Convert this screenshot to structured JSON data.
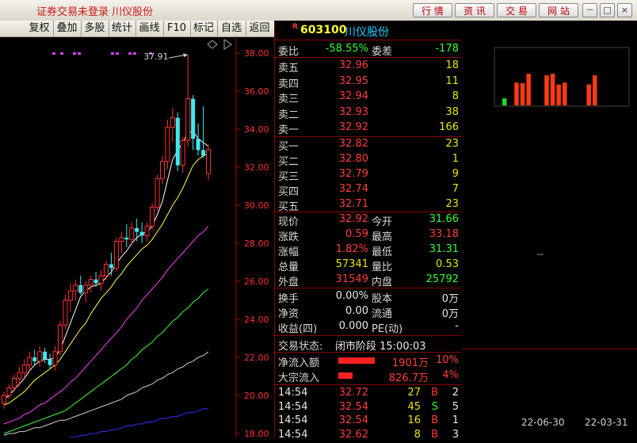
{
  "window": {
    "title": "证券交易未登录 川仪股份"
  },
  "top_buttons": [
    "行 情",
    "资 讯",
    "交 易",
    "网 站"
  ],
  "window_controls": {
    "minimize": "－",
    "maximize": "□",
    "close": "×"
  },
  "toolbar": [
    "复权",
    "叠加",
    "多股",
    "统计",
    "画线",
    "F10",
    "标记",
    "自选",
    "返回"
  ],
  "chart": {
    "y_ticks": [
      "38.00",
      "36.00",
      "34.00",
      "32.00",
      "30.00",
      "28.00",
      "26.00",
      "24.00",
      "22.00",
      "20.00",
      "18.00"
    ],
    "max_marker": "37.91",
    "colors": {
      "up": "#ff3030",
      "down": "#40e8f0",
      "ma5": "#ffffff",
      "ma10": "#ffff40",
      "ma20": "#ff40ff",
      "ma30": "#40ff40",
      "ma60": "#d0d0d0",
      "ma120": "#3030ff",
      "axis": "#b00000",
      "dots": "#d040ff"
    }
  },
  "chart_data": {
    "type": "candlestick",
    "ylim": [
      18,
      38.5
    ],
    "candles": [
      [
        19.6,
        20.2,
        19.3,
        20.0
      ],
      [
        20.0,
        20.6,
        19.8,
        20.4
      ],
      [
        20.4,
        21.1,
        20.2,
        20.9
      ],
      [
        20.9,
        21.5,
        20.5,
        21.2
      ],
      [
        21.2,
        21.9,
        20.9,
        21.6
      ],
      [
        21.6,
        22.3,
        21.3,
        22.0
      ],
      [
        22.0,
        22.4,
        21.6,
        21.8
      ],
      [
        21.8,
        22.6,
        21.5,
        22.3
      ],
      [
        22.3,
        22.5,
        21.7,
        21.9
      ],
      [
        21.9,
        22.2,
        21.4,
        21.6
      ],
      [
        21.6,
        22.6,
        21.3,
        22.3
      ],
      [
        22.3,
        23.9,
        22.1,
        23.7
      ],
      [
        23.7,
        25.3,
        23.5,
        25.0
      ],
      [
        25.0,
        25.9,
        24.4,
        25.5
      ],
      [
        25.5,
        26.1,
        25.0,
        25.8
      ],
      [
        25.8,
        26.3,
        25.3,
        25.4
      ],
      [
        25.4,
        26.0,
        24.9,
        25.8
      ],
      [
        25.8,
        26.3,
        25.4,
        26.1
      ],
      [
        26.1,
        26.5,
        25.7,
        25.9
      ],
      [
        25.9,
        26.6,
        25.5,
        26.3
      ],
      [
        26.3,
        27.1,
        26.1,
        26.9
      ],
      [
        26.9,
        27.5,
        26.3,
        26.7
      ],
      [
        26.7,
        28.3,
        26.5,
        28.1
      ],
      [
        28.1,
        28.6,
        27.5,
        28.3
      ],
      [
        28.3,
        29.0,
        27.8,
        28.2
      ],
      [
        28.2,
        29.1,
        27.9,
        28.8
      ],
      [
        28.8,
        29.3,
        28.1,
        28.6
      ],
      [
        28.6,
        29.1,
        28.0,
        28.4
      ],
      [
        28.4,
        29.1,
        28.1,
        28.9
      ],
      [
        28.9,
        30.1,
        28.7,
        29.9
      ],
      [
        29.9,
        31.6,
        29.7,
        31.4
      ],
      [
        31.4,
        32.6,
        31.1,
        32.3
      ],
      [
        32.3,
        34.5,
        31.9,
        34.1
      ],
      [
        34.1,
        35.1,
        33.3,
        34.6
      ],
      [
        34.6,
        34.9,
        31.8,
        32.1
      ],
      [
        32.1,
        33.6,
        31.7,
        33.4
      ],
      [
        33.4,
        37.91,
        33.1,
        35.6
      ],
      [
        35.6,
        35.8,
        32.9,
        33.5
      ],
      [
        33.5,
        34.3,
        32.6,
        32.9
      ],
      [
        32.9,
        35.2,
        32.5,
        32.6
      ],
      [
        31.66,
        33.18,
        31.31,
        32.92
      ]
    ],
    "ma": {
      "ma5": [
        19.8,
        20.0,
        20.3,
        20.6,
        20.9,
        21.3,
        21.6,
        21.8,
        21.9,
        21.9,
        22.0,
        22.4,
        23.1,
        23.8,
        24.5,
        25.2,
        25.5,
        25.7,
        25.8,
        25.9,
        26.2,
        26.5,
        26.9,
        27.3,
        27.6,
        28.0,
        28.3,
        28.5,
        28.6,
        28.9,
        29.5,
        30.2,
        31.3,
        32.4,
        32.9,
        33.3,
        33.8,
        33.9,
        33.5,
        33.3,
        33.1
      ],
      "ma10": [
        19.5,
        19.6,
        19.8,
        20.0,
        20.2,
        20.5,
        20.8,
        21.0,
        21.2,
        21.4,
        21.6,
        21.9,
        22.3,
        22.7,
        23.1,
        23.5,
        23.8,
        24.3,
        24.7,
        25.1,
        25.4,
        25.7,
        26.1,
        26.4,
        26.8,
        27.1,
        27.4,
        27.7,
        27.9,
        28.2,
        28.6,
        29.0,
        29.5,
        30.0,
        30.4,
        30.9,
        31.5,
        32.1,
        32.4,
        32.6,
        32.7
      ],
      "ma20": [
        18.5,
        18.6,
        18.7,
        18.8,
        19.0,
        19.1,
        19.3,
        19.5,
        19.6,
        19.8,
        20.0,
        20.2,
        20.4,
        20.7,
        20.9,
        21.2,
        21.5,
        21.8,
        22.1,
        22.4,
        22.7,
        23.0,
        23.3,
        23.6,
        24.0,
        24.3,
        24.6,
        25.0,
        25.3,
        25.6,
        25.9,
        26.2,
        26.6,
        26.9,
        27.2,
        27.5,
        27.8,
        28.1,
        28.4,
        28.6,
        28.9
      ],
      "ma30": [
        18.0,
        18.1,
        18.2,
        18.3,
        18.4,
        18.5,
        18.6,
        18.7,
        18.8,
        18.9,
        19.0,
        19.1,
        19.2,
        19.4,
        19.6,
        19.8,
        20.0,
        20.2,
        20.4,
        20.6,
        20.8,
        21.0,
        21.2,
        21.4,
        21.6,
        21.9,
        22.1,
        22.4,
        22.6,
        22.8,
        23.1,
        23.3,
        23.6,
        23.9,
        24.1,
        24.4,
        24.6,
        24.9,
        25.1,
        25.4,
        25.6
      ],
      "ma60": [
        17.9,
        18.0,
        18.0,
        18.1,
        18.1,
        18.2,
        18.3,
        18.3,
        18.4,
        18.5,
        18.6,
        18.7,
        18.7,
        18.8,
        18.9,
        19.0,
        19.1,
        19.2,
        19.3,
        19.4,
        19.5,
        19.6,
        19.7,
        19.8,
        20.0,
        20.1,
        20.2,
        20.4,
        20.5,
        20.6,
        20.8,
        20.9,
        21.1,
        21.2,
        21.4,
        21.5,
        21.7,
        21.8,
        22.0,
        22.1,
        22.3
      ],
      "ma120": [
        17.1,
        17.1,
        17.2,
        17.2,
        17.3,
        17.3,
        17.4,
        17.4,
        17.5,
        17.5,
        17.6,
        17.7,
        17.7,
        17.8,
        17.8,
        17.9,
        17.9,
        18.0,
        18.0,
        18.1,
        18.1,
        18.2,
        18.2,
        18.3,
        18.4,
        18.4,
        18.5,
        18.5,
        18.6,
        18.6,
        18.7,
        18.8,
        18.8,
        18.9,
        18.9,
        19.0,
        19.1,
        19.1,
        19.2,
        19.3,
        19.3
      ]
    }
  },
  "quote": {
    "prefix": "R",
    "code": "603100",
    "name": "川仪股份",
    "webi": {
      "label": "委比",
      "value": "-58.55%",
      "label2": "委差",
      "value2": "-178"
    },
    "sells": [
      {
        "label": "卖五",
        "price": "32.96",
        "vol": "18"
      },
      {
        "label": "卖四",
        "price": "32.95",
        "vol": "11"
      },
      {
        "label": "卖三",
        "price": "32.94",
        "vol": "8"
      },
      {
        "label": "卖二",
        "price": "32.93",
        "vol": "38"
      },
      {
        "label": "卖一",
        "price": "32.92",
        "vol": "166"
      }
    ],
    "buys": [
      {
        "label": "买一",
        "price": "32.82",
        "vol": "23"
      },
      {
        "label": "买二",
        "price": "32.80",
        "vol": "1"
      },
      {
        "label": "买三",
        "price": "32.79",
        "vol": "9"
      },
      {
        "label": "买四",
        "price": "32.74",
        "vol": "7"
      },
      {
        "label": "买五",
        "price": "32.71",
        "vol": "23"
      }
    ],
    "stats": [
      {
        "l1": "现价",
        "v1": "32.92",
        "c1": "red",
        "l2": "今开",
        "v2": "31.66",
        "c2": "green"
      },
      {
        "l1": "涨跌",
        "v1": "0.59",
        "c1": "red",
        "l2": "最高",
        "v2": "33.18",
        "c2": "red"
      },
      {
        "l1": "涨幅",
        "v1": "1.82%",
        "c1": "red",
        "l2": "最低",
        "v2": "31.31",
        "c2": "green"
      },
      {
        "l1": "总量",
        "v1": "57341",
        "c1": "yellow",
        "l2": "量比",
        "v2": "0.53",
        "c2": "yellow"
      },
      {
        "l1": "外盘",
        "v1": "31549",
        "c1": "red",
        "l2": "内盘",
        "v2": "25792",
        "c2": "green"
      }
    ],
    "stats2": [
      {
        "l1": "换手",
        "v1": "0.00%",
        "l2": "股本",
        "v2": "0万"
      },
      {
        "l1": "净资",
        "v1": "0.00",
        "l2": "流通",
        "v2": "0万"
      },
      {
        "l1": "收益(四)",
        "v1": "0.000",
        "l2": "PE(动)",
        "v2": "-"
      }
    ],
    "trade_status": {
      "label": "交易状态:",
      "value": "闭市阶段 15:00:03"
    },
    "flows": [
      {
        "label": "净流入额",
        "value": "1901万",
        "pct": "10%",
        "fraction": 0.1
      },
      {
        "label": "大宗流入",
        "value": "826.7万",
        "pct": "4%",
        "fraction": 0.04
      }
    ],
    "ticks": [
      {
        "time": "14:54",
        "price": "32.72",
        "vol": "27",
        "side": "B",
        "n": "2"
      },
      {
        "time": "14:54",
        "price": "32.54",
        "vol": "45",
        "side": "S",
        "n": "5"
      },
      {
        "time": "14:54",
        "price": "32.54",
        "vol": "16",
        "side": "B",
        "n": "1"
      },
      {
        "time": "14:54",
        "price": "32.62",
        "vol": "8",
        "side": "B",
        "n": "3"
      }
    ]
  },
  "right_panel": {
    "bars": [
      {
        "value": 0.22,
        "color": "green"
      },
      {
        "value": 0.0,
        "color": "none"
      },
      {
        "value": 0.72,
        "color": "red"
      },
      {
        "value": 0.7,
        "color": "red"
      },
      {
        "value": 1.0,
        "color": "red"
      },
      {
        "value": 0.0,
        "color": "none"
      },
      {
        "value": 0.0,
        "color": "none"
      },
      {
        "value": 0.95,
        "color": "red"
      },
      {
        "value": 1.0,
        "color": "red"
      },
      {
        "value": 0.66,
        "color": "red"
      },
      {
        "value": 0.72,
        "color": "red"
      },
      {
        "value": 0.0,
        "color": "none"
      },
      {
        "value": 0.0,
        "color": "none"
      },
      {
        "value": 0.0,
        "color": "none"
      },
      {
        "value": 0.66,
        "color": "red"
      },
      {
        "value": 0.95,
        "color": "red"
      }
    ],
    "dash": "--",
    "dates": [
      "22-06-30",
      "22-03-31"
    ]
  }
}
